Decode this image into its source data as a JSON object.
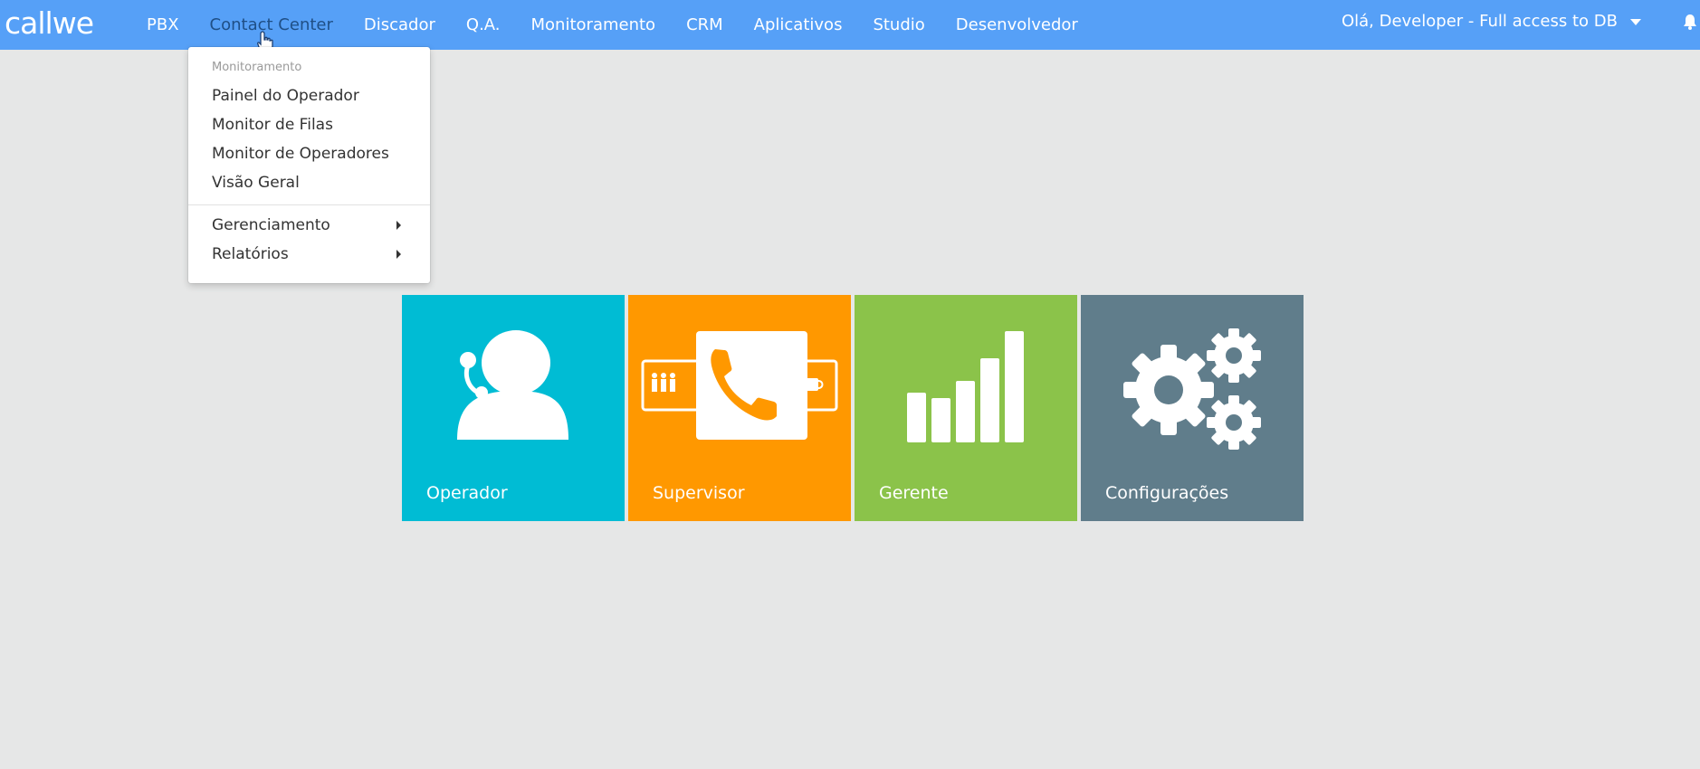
{
  "brand": {
    "logo_text": "callwe"
  },
  "nav": {
    "items": [
      {
        "label": "PBX"
      },
      {
        "label": "Contact Center"
      },
      {
        "label": "Discador"
      },
      {
        "label": "Q.A."
      },
      {
        "label": "Monitoramento"
      },
      {
        "label": "CRM"
      },
      {
        "label": "Aplicativos"
      },
      {
        "label": "Studio"
      },
      {
        "label": "Desenvolvedor"
      }
    ],
    "active": "Contact Center",
    "user_label": "Olá, Developer - Full access to DB"
  },
  "dropdown": {
    "header": "Monitoramento",
    "items": [
      {
        "label": "Painel do Operador"
      },
      {
        "label": "Monitor de Filas"
      },
      {
        "label": "Monitor de Operadores"
      },
      {
        "label": "Visão Geral"
      }
    ],
    "submenus": [
      {
        "label": "Gerenciamento"
      },
      {
        "label": "Relatórios"
      }
    ]
  },
  "tiles": [
    {
      "label": "Operador",
      "color": "#00bcd4",
      "icon": "headset-agent-icon"
    },
    {
      "label": "Supervisor",
      "color": "#ff9800",
      "icon": "phone-queue-icon"
    },
    {
      "label": "Gerente",
      "color": "#8bc34a",
      "icon": "bar-chart-icon"
    },
    {
      "label": "Configurações",
      "color": "#607d8b",
      "icon": "gears-icon"
    }
  ],
  "colors": {
    "navbar": "#56a0f7",
    "background": "#e6e7e7"
  }
}
